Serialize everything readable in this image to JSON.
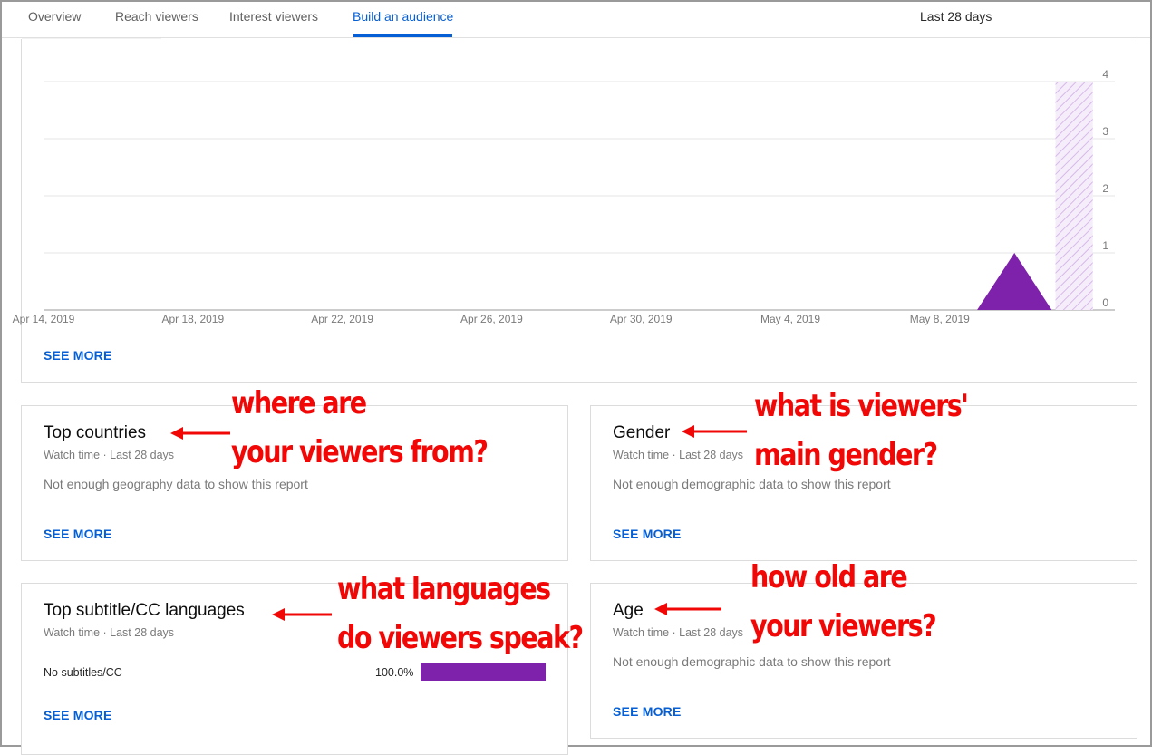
{
  "tabs": [
    {
      "label": "Overview",
      "active": false
    },
    {
      "label": "Reach viewers",
      "active": false
    },
    {
      "label": "Interest viewers",
      "active": false
    },
    {
      "label": "Build an audience",
      "active": true
    }
  ],
  "date_range": "Last 28 days",
  "chart_data": {
    "type": "area",
    "x_tick_labels": [
      "Apr 14, 2019",
      "Apr 18, 2019",
      "Apr 22, 2019",
      "Apr 26, 2019",
      "Apr 30, 2019",
      "May 4, 2019",
      "May 8, 2019"
    ],
    "y_tick_labels": [
      "0",
      "1",
      "2",
      "3",
      "4"
    ],
    "ylim": [
      0,
      4
    ],
    "xlim_days": [
      0,
      29
    ],
    "series": [
      {
        "x_days": [
          0,
          25,
          26,
          27,
          28
        ],
        "values": [
          0,
          0,
          1,
          0,
          0
        ],
        "color": "#7e22ab"
      }
    ],
    "hatched_region": {
      "x_start_days": 27.1,
      "x_end_days": 28.1,
      "y_top": 4,
      "color": "#d7b8ea"
    },
    "grid": true,
    "y_axis_side": "right"
  },
  "main_chart": {
    "see_more": "SEE MORE"
  },
  "cards": {
    "countries": {
      "title": "Top countries",
      "subtitle": "Watch time · Last 28 days",
      "message": "Not enough geography data to show this report",
      "see_more": "SEE MORE"
    },
    "gender": {
      "title": "Gender",
      "subtitle": "Watch time · Last 28 days",
      "message": "Not enough demographic data to show this report",
      "see_more": "SEE MORE"
    },
    "subtitles": {
      "title": "Top subtitle/CC languages",
      "subtitle": "Watch time · Last 28 days",
      "rows": [
        {
          "label": "No subtitles/CC",
          "percent": "100.0%",
          "share": 1.0
        }
      ],
      "see_more": "SEE MORE"
    },
    "age": {
      "title": "Age",
      "subtitle": "Watch time · Last 28 days",
      "message": "Not enough demographic data to show this report",
      "see_more": "SEE MORE"
    }
  },
  "annotations": {
    "countries": [
      "where are",
      "your viewers from?"
    ],
    "gender": [
      "what is viewers'",
      "main gender?"
    ],
    "languages": [
      "what languages",
      "do viewers speak?"
    ],
    "age": [
      "how old are",
      "your viewers?"
    ]
  },
  "colors": {
    "accent": "#065fd4",
    "series": "#7e22ab",
    "annotation": "#f20707"
  }
}
